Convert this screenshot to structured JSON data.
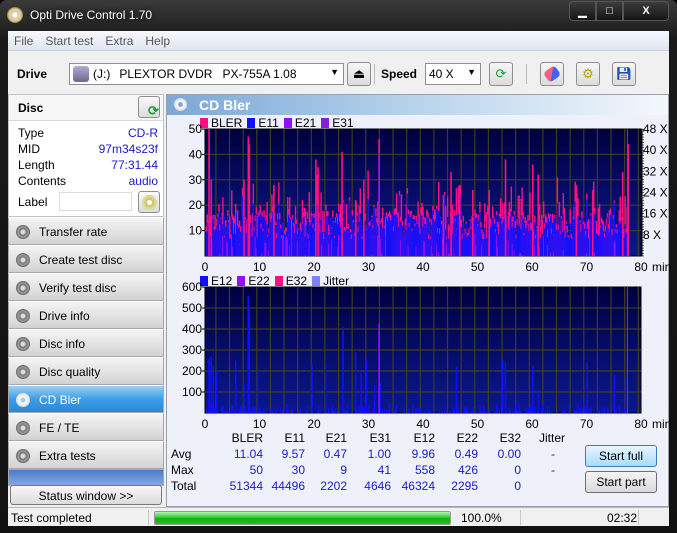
{
  "window": {
    "title": "Opti Drive Control 1.70",
    "controls": {
      "minimize": "▁",
      "maximize": "□",
      "close": "X"
    }
  },
  "menu": [
    "File",
    "Start test",
    "Extra",
    "Help"
  ],
  "toolbar": {
    "drive_label": "Drive",
    "drive_letter": "(J:)",
    "drive_name": "PLEXTOR DVDR   PX-755A 1.08",
    "speed_label": "Speed",
    "speed_value": "40 X",
    "icons": [
      "eject-icon",
      "refresh-icon",
      "erase-icon",
      "settings-icon",
      "save-icon"
    ]
  },
  "disc": {
    "heading": "Disc",
    "rows": [
      {
        "key": "Type",
        "value": "CD-R"
      },
      {
        "key": "MID",
        "value": "97m34s23f"
      },
      {
        "key": "Length",
        "value": "77:31.44"
      },
      {
        "key": "Contents",
        "value": "audio"
      }
    ],
    "label_key": "Label",
    "label_value": ""
  },
  "nav": [
    {
      "label": "Transfer rate",
      "active": false
    },
    {
      "label": "Create test disc",
      "active": false
    },
    {
      "label": "Verify test disc",
      "active": false
    },
    {
      "label": "Drive info",
      "active": false
    },
    {
      "label": "Disc info",
      "active": false
    },
    {
      "label": "Disc quality",
      "active": false
    },
    {
      "label": "CD Bler",
      "active": true
    },
    {
      "label": "FE / TE",
      "active": false
    },
    {
      "label": "Extra tests",
      "active": false
    }
  ],
  "status_window_button": "Status window >>",
  "panel": {
    "title": "CD Bler"
  },
  "colors": {
    "bler": "#ff1080",
    "e11": "#1010ff",
    "e21": "#9010ff",
    "e31": "#8020e0",
    "e12": "#1010ff",
    "e22": "#9010ff",
    "e32": "#ff1080",
    "jitter": "#8080ff",
    "plot_bg_top": "#000040",
    "plot_bg_bottom": "#0a1890",
    "grid": "#403c20"
  },
  "chart_data": [
    {
      "type": "bar",
      "title": "CD Bler (upper)",
      "legend": [
        "BLER",
        "E11",
        "E21",
        "E31"
      ],
      "legend_position": "top-left",
      "xlabel": "min",
      "x_ticks": [
        0,
        10,
        20,
        30,
        40,
        50,
        60,
        70,
        80
      ],
      "xlim": [
        0,
        80
      ],
      "ylim": [
        0,
        50
      ],
      "y_ticks": [
        10,
        20,
        30,
        40,
        50
      ],
      "y2_ticks": [
        "8 X",
        "16 X",
        "24 X",
        "32 X",
        "40 X",
        "48 X"
      ],
      "y2lim": [
        0,
        50
      ],
      "grid": true,
      "disc_end_min": 77.5,
      "peaks": {
        "BLER": [
          [
            0.6,
            50
          ],
          [
            1,
            30
          ],
          [
            7.8,
            47
          ],
          [
            8.0,
            44
          ],
          [
            7,
            30
          ],
          [
            12.5,
            28
          ],
          [
            20.2,
            38
          ],
          [
            20.6,
            35
          ],
          [
            25,
            41
          ],
          [
            27.5,
            22
          ],
          [
            29,
            30
          ],
          [
            31.8,
            46
          ],
          [
            43.6,
            24
          ],
          [
            45,
            33
          ],
          [
            46.6,
            28
          ],
          [
            49,
            26
          ],
          [
            52,
            26
          ],
          [
            55,
            38
          ],
          [
            60,
            36
          ],
          [
            61,
            32
          ],
          [
            68,
            28
          ],
          [
            71,
            26
          ],
          [
            76.5,
            33
          ],
          [
            77.5,
            44
          ]
        ],
        "E11_avg": 9.57,
        "E11_max": 30,
        "BLER_avg": 11.04,
        "E21_max": 9,
        "E31_max": 41
      }
    },
    {
      "type": "bar",
      "title": "CD Bler (lower)",
      "legend": [
        "E12",
        "E22",
        "E32",
        "Jitter"
      ],
      "legend_position": "top-left",
      "xlabel": "min",
      "x_ticks": [
        0,
        10,
        20,
        30,
        40,
        50,
        60,
        70,
        80
      ],
      "xlim": [
        0,
        80
      ],
      "ylim": [
        0,
        600
      ],
      "y_ticks": [
        100,
        200,
        300,
        400,
        500,
        600
      ],
      "grid": true,
      "disc_end_min": 77.5,
      "peaks": {
        "E12": [
          [
            0.6,
            260
          ],
          [
            1.0,
            270
          ],
          [
            1.4,
            220
          ],
          [
            2.0,
            200
          ],
          [
            5.5,
            250
          ],
          [
            7,
            140
          ],
          [
            7.8,
            558
          ],
          [
            8.0,
            510
          ],
          [
            9.5,
            210
          ],
          [
            19.5,
            230
          ],
          [
            22,
            230
          ],
          [
            25.2,
            410
          ],
          [
            27.5,
            290
          ],
          [
            28.5,
            190
          ],
          [
            29.5,
            250
          ],
          [
            31,
            130
          ],
          [
            32,
            145
          ],
          [
            46,
            220
          ],
          [
            54.5,
            250
          ],
          [
            55,
            240
          ],
          [
            60,
            225
          ],
          [
            61,
            100
          ],
          [
            70,
            240
          ],
          [
            75,
            180
          ],
          [
            77,
            170
          ]
        ],
        "E22": [
          [
            31.8,
            426
          ]
        ],
        "E32": []
      }
    }
  ],
  "stats": {
    "columns": [
      "BLER",
      "E11",
      "E21",
      "E31",
      "E12",
      "E22",
      "E32",
      "Jitter"
    ],
    "rows": [
      {
        "label": "Avg",
        "values": [
          "11.04",
          "9.57",
          "0.47",
          "1.00",
          "9.96",
          "0.49",
          "0.00",
          "-"
        ]
      },
      {
        "label": "Max",
        "values": [
          "50",
          "30",
          "9",
          "41",
          "558",
          "426",
          "0",
          "-"
        ]
      },
      {
        "label": "Total",
        "values": [
          "51344",
          "44496",
          "2202",
          "4646",
          "46324",
          "2295",
          "0",
          ""
        ]
      }
    ]
  },
  "buttons": {
    "start_full": "Start full",
    "start_part": "Start part"
  },
  "statusbar": {
    "text": "Test completed",
    "progress_percent": 100,
    "progress_label": "100.0%",
    "time": "02:32"
  }
}
